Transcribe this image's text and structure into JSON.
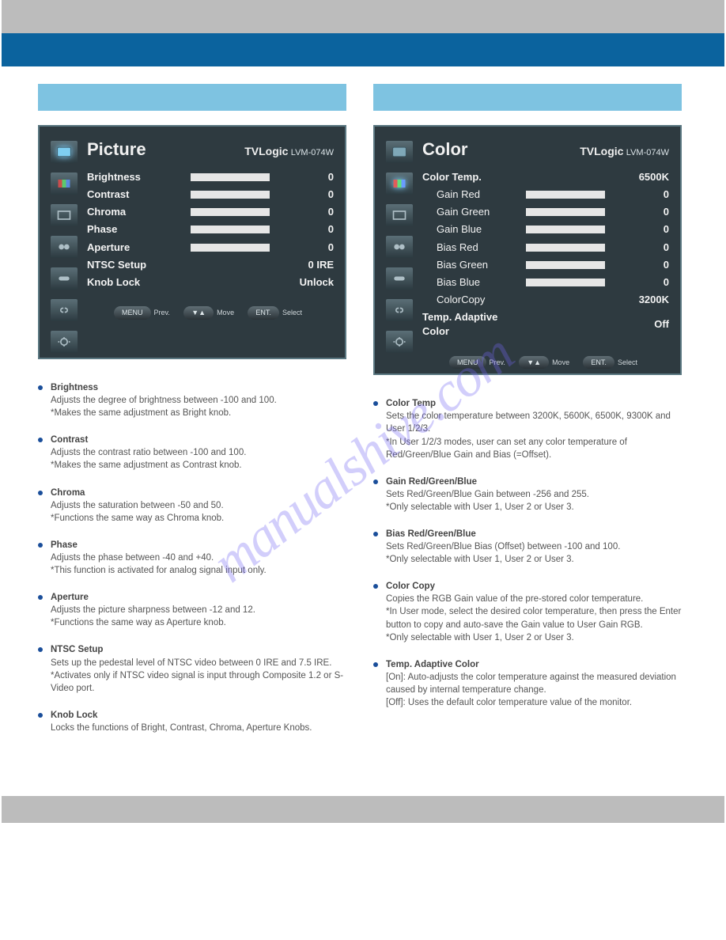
{
  "watermark": "manualshive.com",
  "left": {
    "menu": {
      "title": "Picture",
      "brand": "TVLogic",
      "model": "LVM-074W",
      "rows": [
        {
          "label": "Brightness",
          "value": "0",
          "hasBar": true,
          "sub": false
        },
        {
          "label": "Contrast",
          "value": "0",
          "hasBar": true,
          "sub": false
        },
        {
          "label": "Chroma",
          "value": "0",
          "hasBar": true,
          "sub": false
        },
        {
          "label": "Phase",
          "value": "0",
          "hasBar": true,
          "sub": false
        },
        {
          "label": "Aperture",
          "value": "0",
          "hasBar": true,
          "sub": false
        },
        {
          "label": "NTSC Setup",
          "value": "0 IRE",
          "hasBar": false,
          "sub": false
        },
        {
          "label": "Knob Lock",
          "value": "Unlock",
          "hasBar": false,
          "sub": false
        }
      ],
      "hints": {
        "prev": "MENU",
        "prevLbl": "Prev.",
        "move": "▼▲",
        "moveLbl": "Move",
        "sel": "ENT.",
        "selLbl": "Select"
      }
    },
    "items": [
      {
        "title": "Brightness",
        "body": "Adjusts the degree of brightness between -100 and 100.\n*Makes the same adjustment as Bright knob."
      },
      {
        "title": "Contrast",
        "body": "Adjusts the contrast ratio between -100 and 100.\n*Makes the same adjustment as Contrast knob."
      },
      {
        "title": "Chroma",
        "body": "Adjusts the saturation between -50 and 50.\n*Functions the same way as Chroma knob."
      },
      {
        "title": "Phase",
        "body": "Adjusts the phase between -40 and +40.\n*This function is activated for analog signal input only."
      },
      {
        "title": "Aperture",
        "body": "Adjusts the picture sharpness between -12 and 12.\n*Functions the same way as Aperture knob."
      },
      {
        "title": "NTSC Setup",
        "body": "Sets up the pedestal level of NTSC video between 0 IRE and 7.5 IRE.\n*Activates only if NTSC video signal is input through Composite 1.2 or S-Video port."
      },
      {
        "title": "Knob Lock",
        "body": "Locks the functions of Bright, Contrast, Chroma, Aperture Knobs."
      }
    ]
  },
  "right": {
    "menu": {
      "title": "Color",
      "brand": "TVLogic",
      "model": "LVM-074W",
      "rows": [
        {
          "label": "Color Temp.",
          "value": "6500K",
          "hasBar": false,
          "sub": false
        },
        {
          "label": "Gain Red",
          "value": "0",
          "hasBar": true,
          "sub": true
        },
        {
          "label": "Gain Green",
          "value": "0",
          "hasBar": true,
          "sub": true
        },
        {
          "label": "Gain Blue",
          "value": "0",
          "hasBar": true,
          "sub": true
        },
        {
          "label": "Bias Red",
          "value": "0",
          "hasBar": true,
          "sub": true
        },
        {
          "label": "Bias Green",
          "value": "0",
          "hasBar": true,
          "sub": true
        },
        {
          "label": "Bias Blue",
          "value": "0",
          "hasBar": true,
          "sub": true
        },
        {
          "label": "ColorCopy",
          "value": "3200K",
          "hasBar": false,
          "sub": true
        },
        {
          "label": "Temp. Adaptive Color",
          "value": "Off",
          "hasBar": false,
          "sub": false
        }
      ],
      "hints": {
        "prev": "MENU",
        "prevLbl": "Prev.",
        "move": "▼▲",
        "moveLbl": "Move",
        "sel": "ENT.",
        "selLbl": "Select"
      }
    },
    "items": [
      {
        "title": "Color Temp",
        "body": "Sets the color temperature between 3200K, 5600K, 6500K, 9300K and User 1/2/3.\n*In User 1/2/3 modes, user can set any color temperature of Red/Green/Blue Gain and Bias (=Offset)."
      },
      {
        "title": "Gain Red/Green/Blue",
        "body": "Sets Red/Green/Blue Gain between -256 and 255.\n*Only selectable with User 1, User 2 or User 3."
      },
      {
        "title": "Bias Red/Green/Blue",
        "body": "Sets Red/Green/Blue Bias (Offset) between -100 and 100.\n*Only selectable with User 1, User 2 or User 3."
      },
      {
        "title": "Color Copy",
        "body": "Copies the RGB Gain value of the pre-stored color temperature.\n*In User mode, select the desired color temperature, then press the Enter button to copy and auto-save the Gain value to User Gain RGB.\n*Only selectable with User 1, User 2 or User 3."
      },
      {
        "title": "Temp. Adaptive Color",
        "body": "[On]: Auto-adjusts the color temperature against the measured deviation caused by internal temperature change.\n[Off]: Uses the default color temperature value of the monitor."
      }
    ]
  }
}
